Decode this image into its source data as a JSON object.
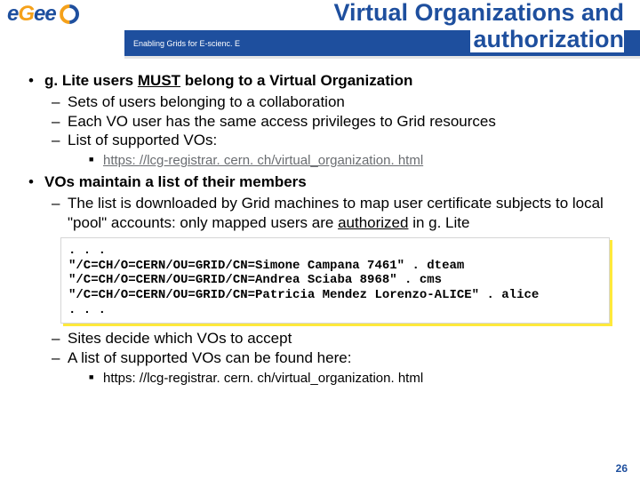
{
  "header": {
    "logo": {
      "e1": "e",
      "g": "G",
      "e2": "e",
      "e3": "e"
    },
    "tagline": "Enabling Grids for E-scienc. E",
    "title_line1": "Virtual Organizations and",
    "title_line2": "authorization"
  },
  "content": {
    "b1_lead": "g. Lite users ",
    "b1_must": "MUST",
    "b1_tail": " belong to a Virtual Organization",
    "b1_s1": "Sets of users belonging to a collaboration",
    "b1_s2": "Each VO user has the same access privileges to Grid resources",
    "b1_s3": "List of supported VOs:",
    "b1_link": "https: //lcg-registrar. cern. ch/virtual_organization. html",
    "b2_head": "VOs maintain a list of their members",
    "b2_s1_a": "The list is downloaded by Grid machines to map user certificate subjects to local \"pool\" accounts: only mapped users are ",
    "b2_s1_auth": "authorized",
    "b2_s1_b": " in g. Lite",
    "code": ". . .\n\"/C=CH/O=CERN/OU=GRID/CN=Simone Campana 7461\" . dteam\n\"/C=CH/O=CERN/OU=GRID/CN=Andrea Sciaba 8968\" . cms\n\"/C=CH/O=CERN/OU=GRID/CN=Patricia Mendez Lorenzo-ALICE\" . alice\n. . .",
    "b2_s2": "Sites decide which VOs to accept",
    "b2_s3": "A list of supported VOs can be found here:",
    "b2_link": "https: //lcg-registrar. cern. ch/virtual_organization. html"
  },
  "pagenum": "26"
}
